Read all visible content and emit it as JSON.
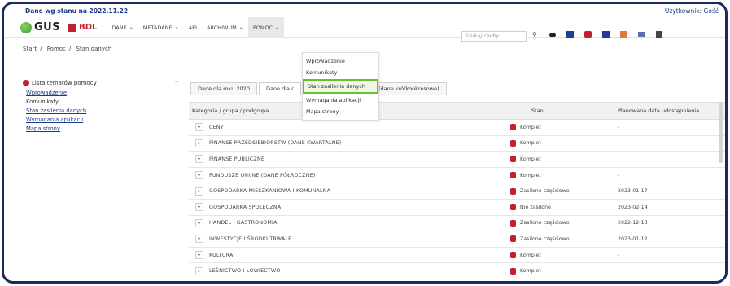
{
  "topbar": {
    "date": "Dane wg stanu na 2022.11.22",
    "user": "Użytkownik: Gość"
  },
  "logos": {
    "gus": "GUS",
    "bdl": "BDL"
  },
  "nav": [
    {
      "label": "DANE",
      "chevron": true,
      "active": false
    },
    {
      "label": "METADANE",
      "chevron": true,
      "active": false
    },
    {
      "label": "API",
      "chevron": false,
      "active": false
    },
    {
      "label": "ARCHIWUM",
      "chevron": true,
      "active": false
    },
    {
      "label": "POMOC",
      "chevron": true,
      "active": true
    }
  ],
  "search": {
    "placeholder": "Szukaj cechy"
  },
  "breadcrumb": [
    "Start",
    "Pomoc",
    "Stan danych"
  ],
  "sidebar": {
    "title": "Lista tematów pomocy",
    "items": [
      "Wprowadzenie",
      "Komunikaty",
      "Stan zasilenia danych",
      "Wymagania aplikacji",
      "Mapa strony"
    ]
  },
  "dropdown": {
    "items": [
      "Wprowadzenie",
      "Komunikaty",
      "Stan zasilenia danych",
      "Wymagania aplikacji",
      "Mapa strony"
    ],
    "highlighted": "Stan zasilenia danych"
  },
  "tabs": [
    "Dane dla roku 2020",
    "Dane dla r",
    "2 (dane krótkookresowe)"
  ],
  "table": {
    "headers": {
      "category": "Kategoria / grupa / podgrupa",
      "status": "Stan",
      "planned": "Planowana data udostępnienia"
    },
    "rows": [
      {
        "name": "CENY",
        "status": "Komplet",
        "date": "-"
      },
      {
        "name": "FINANSE PRZEDSIĘBIORSTW (DANE KWARTALNE)",
        "status": "Komplet",
        "date": "-"
      },
      {
        "name": "FINANSE PUBLICZNE",
        "status": "Komplet",
        "date": ""
      },
      {
        "name": "FUNDUSZE UNIJNE (DANE PÓŁROCZNE)",
        "status": "Komplet",
        "date": "-"
      },
      {
        "name": "GOSPODARKA MIESZKANIOWA I KOMUNALNA",
        "status": "Zasilone częściowo",
        "date": "2023-01-17"
      },
      {
        "name": "GOSPODARKA SPOŁECZNA",
        "status": "Nie zasilone",
        "date": "2023-02-14"
      },
      {
        "name": "HANDEL I GASTRONOMIA",
        "status": "Zasilone częściowo",
        "date": "2022-12-13"
      },
      {
        "name": "INWESTYCJE I ŚRODKI TRWAŁE",
        "status": "Zasilone częściowo",
        "date": "2023-01-12"
      },
      {
        "name": "KULTURA",
        "status": "Komplet",
        "date": "-"
      },
      {
        "name": "LEŚNICTWO I ŁOWIECTWO",
        "status": "Komplet",
        "date": "-"
      }
    ]
  },
  "colors": {
    "frame": "#1d2a5e",
    "brand_red": "#c3202d",
    "link_blue": "#1d3e8a",
    "highlight_green": "#6bbf2c"
  }
}
